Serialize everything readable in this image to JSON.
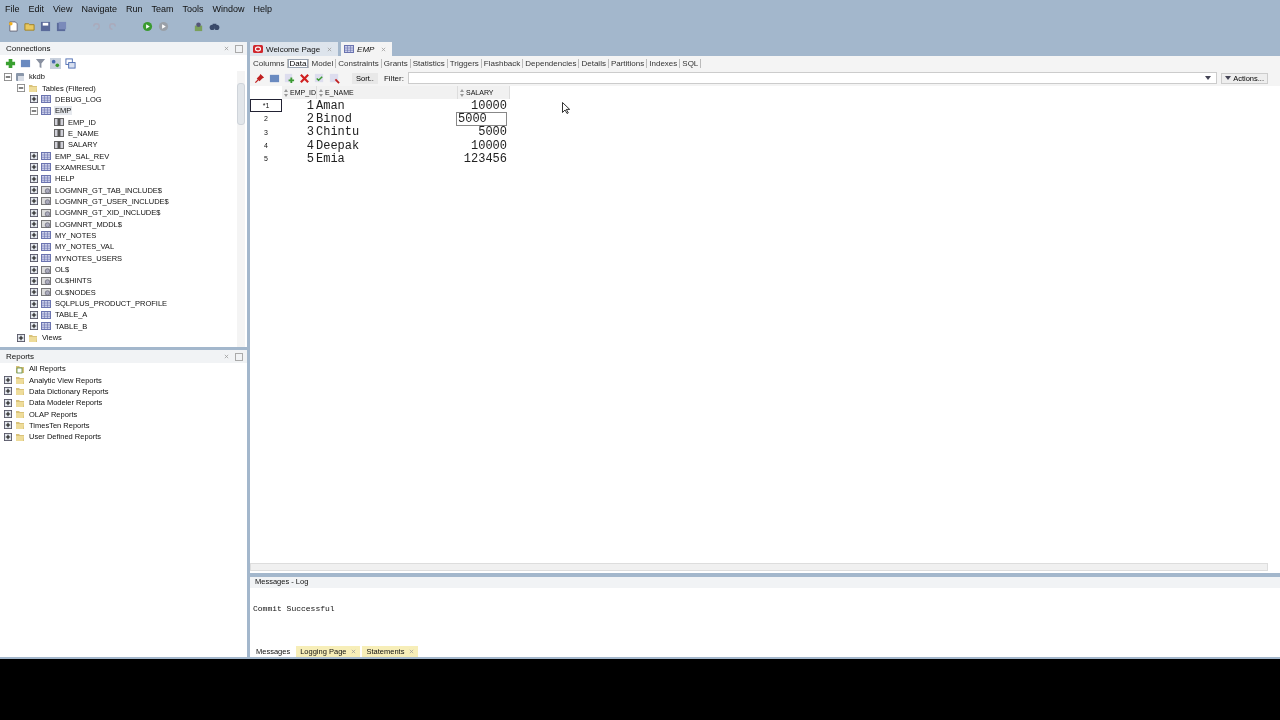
{
  "menu": [
    "File",
    "Edit",
    "View",
    "Navigate",
    "Run",
    "Team",
    "Tools",
    "Window",
    "Help"
  ],
  "connections": {
    "title": "Connections",
    "tree": [
      {
        "label": "kkdb",
        "kind": "database",
        "expanded": true,
        "selected": false,
        "children": [
          {
            "label": "Tables (Filtered)",
            "kind": "folder",
            "expanded": true,
            "selected": false,
            "children": [
              {
                "label": "DEBUG_LOG",
                "kind": "table",
                "expanded": false,
                "selected": false
              },
              {
                "label": "EMP",
                "kind": "table",
                "expanded": true,
                "selected": true,
                "children": [
                  {
                    "label": "EMP_ID",
                    "kind": "column",
                    "selected": false
                  },
                  {
                    "label": "E_NAME",
                    "kind": "column",
                    "selected": false
                  },
                  {
                    "label": "SALARY",
                    "kind": "column",
                    "selected": false
                  }
                ]
              },
              {
                "label": "EMP_SAL_REV",
                "kind": "table",
                "expanded": false,
                "selected": false
              },
              {
                "label": "EXAMRESULT",
                "kind": "table",
                "expanded": false,
                "selected": false
              },
              {
                "label": "HELP",
                "kind": "table",
                "expanded": false,
                "selected": false
              },
              {
                "label": "LOGMNR_GT_TAB_INCLUDE$",
                "kind": "temptable",
                "expanded": false,
                "selected": false
              },
              {
                "label": "LOGMNR_GT_USER_INCLUDE$",
                "kind": "temptable",
                "expanded": false,
                "selected": false
              },
              {
                "label": "LOGMNR_GT_XID_INCLUDE$",
                "kind": "temptable",
                "expanded": false,
                "selected": false
              },
              {
                "label": "LOGMNRT_MDDL$",
                "kind": "temptable",
                "expanded": false,
                "selected": false
              },
              {
                "label": "MY_NOTES",
                "kind": "table",
                "expanded": false,
                "selected": false
              },
              {
                "label": "MY_NOTES_VAL",
                "kind": "table",
                "expanded": false,
                "selected": false
              },
              {
                "label": "MYNOTES_USERS",
                "kind": "table",
                "expanded": false,
                "selected": false
              },
              {
                "label": "OL$",
                "kind": "temptable",
                "expanded": false,
                "selected": false
              },
              {
                "label": "OL$HINTS",
                "kind": "temptable",
                "expanded": false,
                "selected": false
              },
              {
                "label": "OL$NODES",
                "kind": "temptable",
                "expanded": false,
                "selected": false
              },
              {
                "label": "SQLPLUS_PRODUCT_PROFILE",
                "kind": "table",
                "expanded": false,
                "selected": false
              },
              {
                "label": "TABLE_A",
                "kind": "table",
                "expanded": false,
                "selected": false
              },
              {
                "label": "TABLE_B",
                "kind": "table",
                "expanded": false,
                "selected": false
              }
            ]
          },
          {
            "label": "Views",
            "kind": "folder",
            "expanded": false,
            "selected": false
          }
        ]
      }
    ]
  },
  "reports": {
    "title": "Reports",
    "tree": [
      {
        "label": "All Reports",
        "kind": "reports",
        "selected": false
      },
      {
        "label": "Analytic View Reports",
        "kind": "folder",
        "expanded": false,
        "selected": false
      },
      {
        "label": "Data Dictionary Reports",
        "kind": "folder",
        "expanded": false,
        "selected": false
      },
      {
        "label": "Data Modeler Reports",
        "kind": "folder",
        "expanded": false,
        "selected": false
      },
      {
        "label": "OLAP Reports",
        "kind": "folder",
        "expanded": false,
        "selected": false
      },
      {
        "label": "TimesTen Reports",
        "kind": "folder",
        "expanded": false,
        "selected": false
      },
      {
        "label": "User Defined Reports",
        "kind": "folder",
        "expanded": false,
        "selected": false
      }
    ]
  },
  "editor_tabs": [
    {
      "label": "Welcome Page",
      "kind": "welcome",
      "selected": false
    },
    {
      "label": "EMP",
      "kind": "table",
      "selected": true
    }
  ],
  "sub_tabs": [
    {
      "label": "Columns",
      "selected": false
    },
    {
      "label": "Data",
      "selected": true
    },
    {
      "label": "Model",
      "selected": false
    },
    {
      "label": "Constraints",
      "selected": false
    },
    {
      "label": "Grants",
      "selected": false
    },
    {
      "label": "Statistics",
      "selected": false
    },
    {
      "label": "Triggers",
      "selected": false
    },
    {
      "label": "Flashback",
      "selected": false
    },
    {
      "label": "Dependencies",
      "selected": false
    },
    {
      "label": "Details",
      "selected": false
    },
    {
      "label": "Partitions",
      "selected": false
    },
    {
      "label": "Indexes",
      "selected": false
    },
    {
      "label": "SQL",
      "selected": false
    }
  ],
  "data_toolbar": {
    "sort": "Sort..",
    "filter_label": "Filter:",
    "actions": "Actions..."
  },
  "table": {
    "columns": [
      "EMP_ID",
      "E_NAME",
      "SALARY"
    ],
    "rows": [
      {
        "row_number": "*1",
        "selected": true,
        "editing": false,
        "cells": [
          "1",
          "Aman",
          "10000"
        ]
      },
      {
        "row_number": "2",
        "selected": false,
        "editing": true,
        "cells": [
          "2",
          "Binod",
          "5000"
        ]
      },
      {
        "row_number": "3",
        "selected": false,
        "editing": false,
        "cells": [
          "3",
          "Chintu",
          "5000"
        ]
      },
      {
        "row_number": "4",
        "selected": false,
        "editing": false,
        "cells": [
          "4",
          "Deepak",
          "10000"
        ]
      },
      {
        "row_number": "5",
        "selected": false,
        "editing": false,
        "cells": [
          "5",
          "Emia",
          "123456"
        ]
      }
    ]
  },
  "messages": {
    "title": "Messages - Log",
    "text": "Commit Successful",
    "tabs": [
      {
        "label": "Messages",
        "selected": true,
        "closable": false
      },
      {
        "label": "Logging Page",
        "selected": false,
        "closable": true
      },
      {
        "label": "Statements",
        "selected": false,
        "closable": true
      }
    ]
  }
}
